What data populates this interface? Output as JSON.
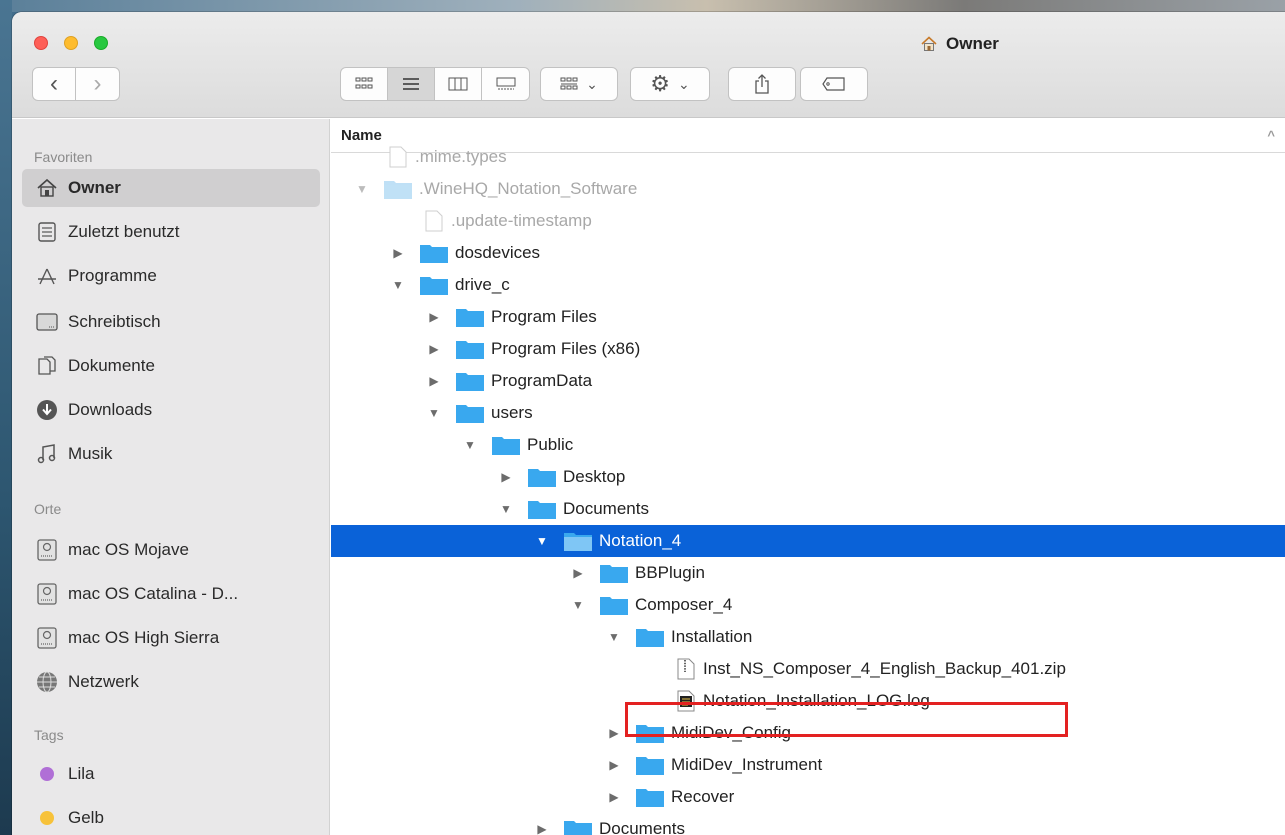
{
  "window": {
    "title": "Owner",
    "title_icon": "home-icon"
  },
  "toolbar": {
    "back": "‹",
    "forward": "›",
    "views": [
      "icon-view",
      "list-view",
      "column-view",
      "gallery-view"
    ],
    "group_icon": "group-by-icon",
    "action_icon": "gear-icon",
    "share_icon": "share-icon",
    "tag_icon": "tag-icon",
    "chevron": "⌄"
  },
  "sidebar": {
    "favorites_label": "Favoriten",
    "favorites": [
      {
        "label": "Owner",
        "icon": "home-icon"
      },
      {
        "label": "Zuletzt benutzt",
        "icon": "recents-icon"
      },
      {
        "label": "Programme",
        "icon": "applications-icon"
      },
      {
        "label": "Schreibtisch",
        "icon": "desktop-icon"
      },
      {
        "label": "Dokumente",
        "icon": "documents-icon"
      },
      {
        "label": "Downloads",
        "icon": "downloads-icon"
      },
      {
        "label": "Musik",
        "icon": "music-icon"
      }
    ],
    "places_label": "Orte",
    "places": [
      {
        "label": "mac OS Mojave",
        "icon": "disk-icon"
      },
      {
        "label": "mac OS Catalina - D...",
        "icon": "disk-icon"
      },
      {
        "label": "mac OS High Sierra",
        "icon": "disk-icon"
      },
      {
        "label": "Netzwerk",
        "icon": "network-icon"
      }
    ],
    "tags_label": "Tags",
    "tags": [
      {
        "label": "Lila",
        "color": "#b06fd6"
      },
      {
        "label": "Gelb",
        "color": "#f7c23a"
      }
    ]
  },
  "list": {
    "column_name": "Name",
    "rows": [
      {
        "name": ".mime.types",
        "type": "file",
        "depth": 0,
        "disclosure": "",
        "faded": true
      },
      {
        "name": ".WineHQ_Notation_Software",
        "type": "folder",
        "depth": 0,
        "disclosure": "open",
        "faded": true
      },
      {
        "name": ".update-timestamp",
        "type": "file",
        "depth": 1,
        "disclosure": "",
        "faded": true
      },
      {
        "name": "dosdevices",
        "type": "folder",
        "depth": 1,
        "disclosure": "closed"
      },
      {
        "name": "drive_c",
        "type": "folder",
        "depth": 1,
        "disclosure": "open"
      },
      {
        "name": "Program Files",
        "type": "folder",
        "depth": 2,
        "disclosure": "closed"
      },
      {
        "name": "Program Files (x86)",
        "type": "folder",
        "depth": 2,
        "disclosure": "closed"
      },
      {
        "name": "ProgramData",
        "type": "folder",
        "depth": 2,
        "disclosure": "closed"
      },
      {
        "name": "users",
        "type": "folder",
        "depth": 2,
        "disclosure": "open"
      },
      {
        "name": "Public",
        "type": "folder",
        "depth": 3,
        "disclosure": "open"
      },
      {
        "name": "Desktop",
        "type": "folder",
        "depth": 4,
        "disclosure": "closed"
      },
      {
        "name": "Documents",
        "type": "folder",
        "depth": 4,
        "disclosure": "open"
      },
      {
        "name": "Notation_4",
        "type": "folder",
        "depth": 5,
        "disclosure": "open",
        "selected": true
      },
      {
        "name": "BBPlugin",
        "type": "folder",
        "depth": 6,
        "disclosure": "closed"
      },
      {
        "name": "Composer_4",
        "type": "folder",
        "depth": 6,
        "disclosure": "open"
      },
      {
        "name": "Installation",
        "type": "folder",
        "depth": 7,
        "disclosure": "open"
      },
      {
        "name": "Inst_NS_Composer_4_English_Backup_401.zip",
        "type": "zip",
        "depth": 8,
        "disclosure": ""
      },
      {
        "name": "Notation_Installation_LOG.log",
        "type": "log",
        "depth": 8,
        "disclosure": "",
        "highlighted": true
      },
      {
        "name": "MidiDev_Config",
        "type": "folder",
        "depth": 7,
        "disclosure": "closed"
      },
      {
        "name": "MidiDev_Instrument",
        "type": "folder",
        "depth": 7,
        "disclosure": "closed"
      },
      {
        "name": "Recover",
        "type": "folder",
        "depth": 7,
        "disclosure": "closed"
      },
      {
        "name": "Documents",
        "type": "folder",
        "depth": 5,
        "disclosure": "closed"
      }
    ]
  },
  "colors": {
    "selection": "#0a62d8",
    "highlight_border": "#e32121",
    "folder": "#39a8ee"
  }
}
